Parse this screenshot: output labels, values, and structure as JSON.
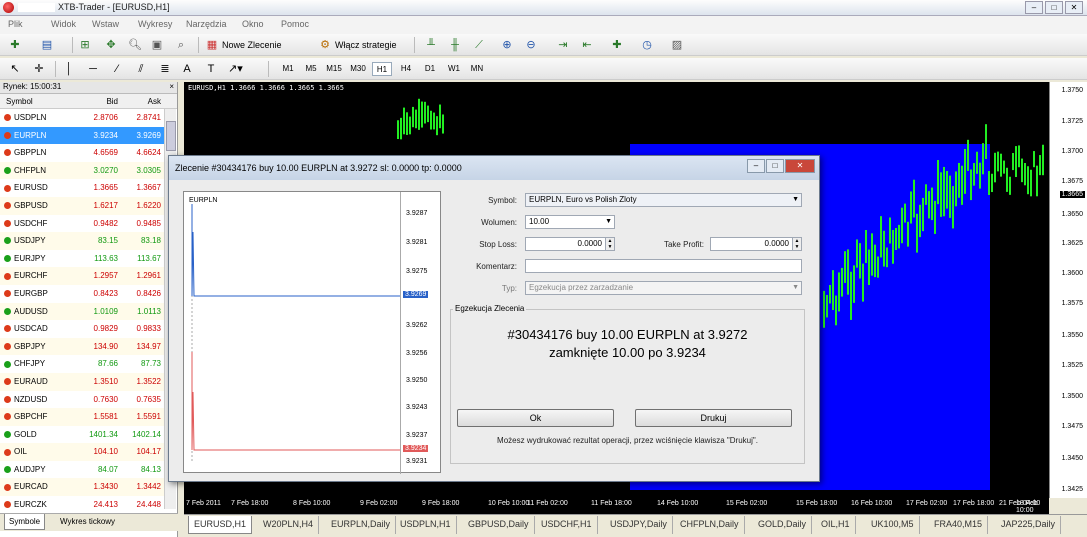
{
  "window": {
    "title": "XTB-Trader - [EURUSD,H1]"
  },
  "menu": [
    "Plik",
    "Widok",
    "Wstaw",
    "Wykresy",
    "Narzędzia",
    "Okno",
    "Pomoc"
  ],
  "toolbar": {
    "new_order": "Nowe Zlecenie",
    "strategies": "Włącz strategie"
  },
  "timeframes": [
    "M1",
    "M5",
    "M15",
    "M30",
    "H1",
    "H4",
    "D1",
    "W1",
    "MN"
  ],
  "active_timeframe": "H1",
  "market_watch": {
    "title": "Rynek: 15:00:31",
    "headers": {
      "symbol": "Symbol",
      "bid": "Bid",
      "ask": "Ask"
    },
    "rows": [
      {
        "symbol": "USDPLN",
        "bid": "2.8706",
        "ask": "2.8741",
        "dir": "down"
      },
      {
        "symbol": "EURPLN",
        "bid": "3.9234",
        "ask": "3.9269",
        "dir": "down",
        "selected": true
      },
      {
        "symbol": "GBPPLN",
        "bid": "4.6569",
        "ask": "4.6624",
        "dir": "down"
      },
      {
        "symbol": "CHFPLN",
        "bid": "3.0270",
        "ask": "3.0305",
        "dir": "up"
      },
      {
        "symbol": "EURUSD",
        "bid": "1.3665",
        "ask": "1.3667",
        "dir": "down"
      },
      {
        "symbol": "GBPUSD",
        "bid": "1.6217",
        "ask": "1.6220",
        "dir": "down"
      },
      {
        "symbol": "USDCHF",
        "bid": "0.9482",
        "ask": "0.9485",
        "dir": "down"
      },
      {
        "symbol": "USDJPY",
        "bid": "83.15",
        "ask": "83.18",
        "dir": "up"
      },
      {
        "symbol": "EURJPY",
        "bid": "113.63",
        "ask": "113.67",
        "dir": "up"
      },
      {
        "symbol": "EURCHF",
        "bid": "1.2957",
        "ask": "1.2961",
        "dir": "down"
      },
      {
        "symbol": "EURGBP",
        "bid": "0.8423",
        "ask": "0.8426",
        "dir": "down"
      },
      {
        "symbol": "AUDUSD",
        "bid": "1.0109",
        "ask": "1.0113",
        "dir": "up"
      },
      {
        "symbol": "USDCAD",
        "bid": "0.9829",
        "ask": "0.9833",
        "dir": "down"
      },
      {
        "symbol": "GBPJPY",
        "bid": "134.90",
        "ask": "134.97",
        "dir": "down"
      },
      {
        "symbol": "CHFJPY",
        "bid": "87.66",
        "ask": "87.73",
        "dir": "up"
      },
      {
        "symbol": "EURAUD",
        "bid": "1.3510",
        "ask": "1.3522",
        "dir": "down"
      },
      {
        "symbol": "NZDUSD",
        "bid": "0.7630",
        "ask": "0.7635",
        "dir": "down"
      },
      {
        "symbol": "GBPCHF",
        "bid": "1.5581",
        "ask": "1.5591",
        "dir": "down"
      },
      {
        "symbol": "GOLD",
        "bid": "1401.34",
        "ask": "1402.14",
        "dir": "up"
      },
      {
        "symbol": "OIL",
        "bid": "104.10",
        "ask": "104.17",
        "dir": "down"
      },
      {
        "symbol": "AUDJPY",
        "bid": "84.07",
        "ask": "84.13",
        "dir": "up"
      },
      {
        "symbol": "EURCAD",
        "bid": "1.3430",
        "ask": "1.3442",
        "dir": "down"
      },
      {
        "symbol": "EURCZK",
        "bid": "24.413",
        "ask": "24.448",
        "dir": "down"
      }
    ],
    "tabs": [
      "Symbole",
      "Wykres tickowy"
    ]
  },
  "chart": {
    "label": "EURUSD,H1 1.3666 1.3666 1.3665 1.3665",
    "price_labels": [
      "1.3750",
      "1.3725",
      "1.3700",
      "1.3675",
      "1.3665",
      "1.3650",
      "1.3625",
      "1.3600",
      "1.3575",
      "1.3550",
      "1.3525",
      "1.3500",
      "1.3475",
      "1.3450",
      "1.3425"
    ],
    "current_price": "1.3665",
    "time_labels": [
      "7 Feb 2011",
      "7 Feb 18:00",
      "8 Feb 10:00",
      "9 Feb 02:00",
      "9 Feb 18:00",
      "10 Feb 10:00",
      "11 Feb 02:00",
      "11 Feb 18:00",
      "14 Feb 10:00",
      "15 Feb 02:00",
      "15 Feb 18:00",
      "16 Feb 10:00",
      "17 Feb 02:00",
      "17 Feb 18:00",
      "18 Feb 10:00",
      "18 Feb 11:00",
      "21 Feb 04:00"
    ]
  },
  "chart_tabs": [
    "EURUSD,H1",
    "W20PLN,H4",
    "EURPLN,Daily",
    "USDPLN,H1",
    "GBPUSD,Daily",
    "USDCHF,H1",
    "USDJPY,Daily",
    "CHFPLN,Daily",
    "GOLD,Daily",
    "OIL,H1",
    "UK100,M5",
    "FRA40,M15",
    "JAP225,Daily"
  ],
  "active_chart_tab": "EURUSD,H1",
  "dialog": {
    "title": "Zlecenie #30434176 buy 10.00 EURPLN at 3.9272 sl: 0.0000 tp: 0.0000",
    "mini_chart": {
      "symbol": "EURPLN",
      "axis_labels": [
        "3.9287",
        "3.9281",
        "3.9275",
        "3.9262",
        "3.9256",
        "3.9250",
        "3.9243",
        "3.9237",
        "3.9231"
      ],
      "ask_label": "3.9269",
      "bid_label": "3.9234"
    },
    "form": {
      "symbol_label": "Symbol:",
      "symbol_value": "EURPLN, Euro vs Polish Zloty",
      "volume_label": "Wolumen:",
      "volume_value": "10.00",
      "stop_loss_label": "Stop Loss:",
      "stop_loss_value": "0.0000",
      "take_profit_label": "Take Profit:",
      "take_profit_value": "0.0000",
      "comment_label": "Komentarz:",
      "comment_value": "",
      "type_label": "Typ:",
      "type_value": "Egzekucja przez zarzadzanie"
    },
    "group_title": "Egzekucja Zlecenia",
    "result_line1": "#30434176 buy 10.00 EURPLN at 3.9272",
    "result_line2": "zamknięte 10.00 po 3.9234",
    "ok_button": "Ok",
    "print_button": "Drukuj",
    "hint": "Możesz wydrukować rezultat operacji, przez wciśnięcie klawisza \"Drukuj\"."
  }
}
